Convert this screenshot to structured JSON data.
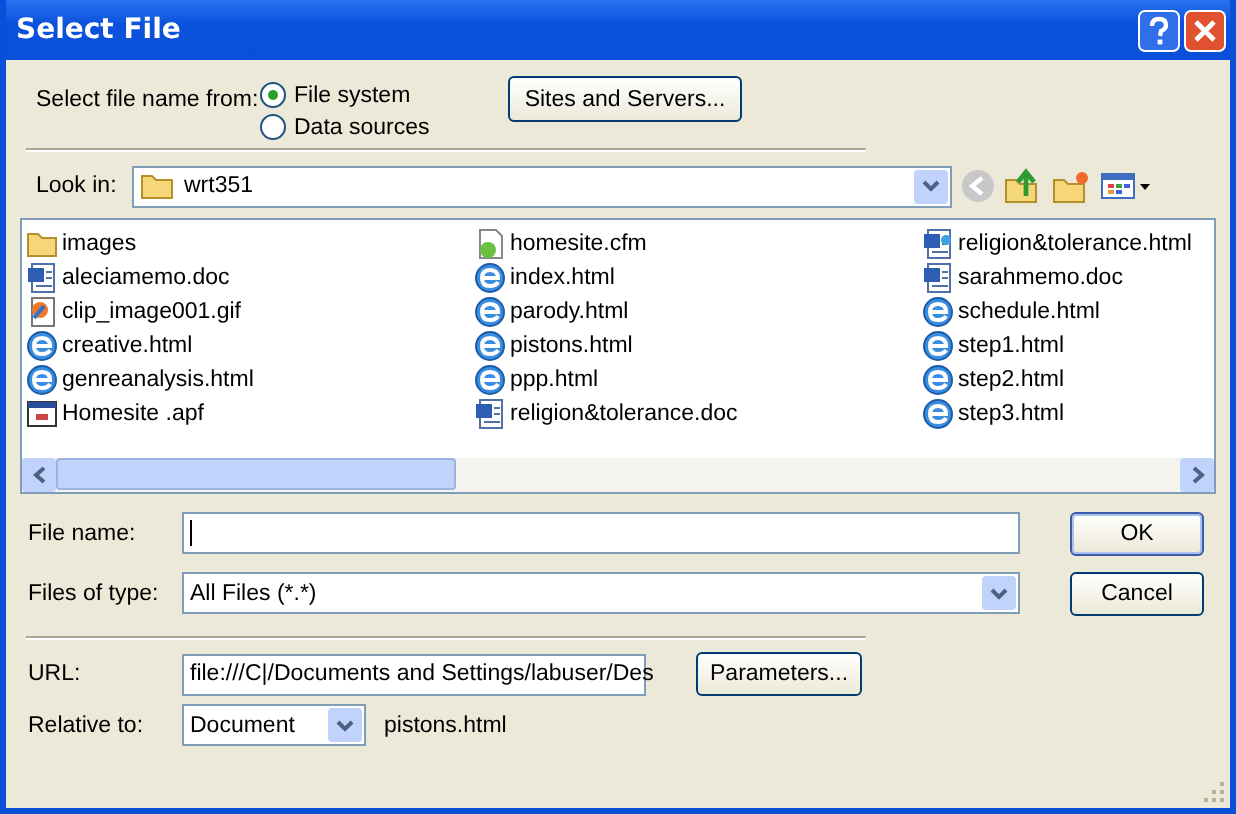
{
  "window": {
    "title": "Select File"
  },
  "source": {
    "label": "Select file name from:",
    "options": [
      {
        "label": "File system",
        "selected": true
      },
      {
        "label": "Data sources",
        "selected": false
      }
    ],
    "button": "Sites and Servers..."
  },
  "look_in": {
    "label": "Look in:",
    "value": "wrt351"
  },
  "files": [
    {
      "name": "images",
      "kind": "folder"
    },
    {
      "name": "aleciamemo.doc",
      "kind": "word"
    },
    {
      "name": "clip_image001.gif",
      "kind": "image"
    },
    {
      "name": "creative.html",
      "kind": "web"
    },
    {
      "name": "genreanalysis.html",
      "kind": "web"
    },
    {
      "name": "Homesite .apf",
      "kind": "app"
    },
    {
      "name": "homesite.cfm",
      "kind": "cfm"
    },
    {
      "name": "index.html",
      "kind": "web"
    },
    {
      "name": "parody.html",
      "kind": "web"
    },
    {
      "name": "pistons.html",
      "kind": "web"
    },
    {
      "name": "ppp.html",
      "kind": "web"
    },
    {
      "name": "religion&tolerance.doc",
      "kind": "word"
    },
    {
      "name": "religion&tolerance.html",
      "kind": "wordweb"
    },
    {
      "name": "sarahmemo.doc",
      "kind": "word"
    },
    {
      "name": "schedule.html",
      "kind": "web"
    },
    {
      "name": "step1.html",
      "kind": "web"
    },
    {
      "name": "step2.html",
      "kind": "web"
    },
    {
      "name": "step3.html",
      "kind": "web"
    }
  ],
  "file_name": {
    "label": "File name:"
  },
  "file_type": {
    "label": "Files of type:",
    "value": "All Files (*.*)"
  },
  "buttons": [
    "OK",
    "Cancel"
  ],
  "url": {
    "label": "URL:",
    "value": "file:///C|/Documents and Settings/labuser/Des",
    "button": "Parameters..."
  },
  "relative": {
    "label": "Relative to:",
    "value": "Document",
    "file": "pistons.html"
  }
}
